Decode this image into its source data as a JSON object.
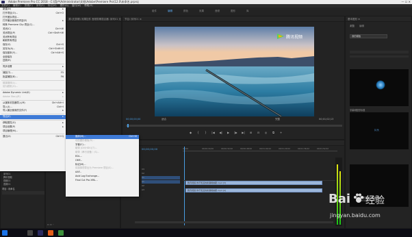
{
  "window": {
    "title": "Adobe Premiere Pro CC 2018 - C:\\用户\\Administrator\\文档\\Adobe\\Premiere Pro\\12.0\\未命名.prproj"
  },
  "menubar": [
    "文件(F)",
    "编辑(E)",
    "剪辑(C)",
    "序列(S)",
    "标记(M)",
    "图形(G)",
    "窗口(W)",
    "帮助(H)"
  ],
  "workspaces": {
    "items": [
      "组件",
      "编辑",
      "颜色",
      "效果",
      "音频",
      "图形",
      "库"
    ],
    "active": "编辑"
  },
  "file_menu": {
    "groups": [
      [
        {
          "label": "新建(N)",
          "shortcut": "▸"
        },
        {
          "label": "打开项目(O)...",
          "shortcut": "Ctrl+O"
        },
        {
          "label": "打开团队项目...",
          "shortcut": ""
        },
        {
          "label": "打开最近使用的内容(E)",
          "shortcut": "▸"
        },
        {
          "label": "转换 Premiere Clip 项目(C)...",
          "shortcut": ""
        },
        {
          "label": "关闭(C)",
          "shortcut": "Ctrl+W"
        },
        {
          "label": "关闭项目(P)",
          "shortcut": "Ctrl+Shift+W"
        },
        {
          "label": "关闭所有项目",
          "shortcut": ""
        },
        {
          "label": "刷新所有项目",
          "shortcut": ""
        },
        {
          "label": "保存(S)",
          "shortcut": "Ctrl+S"
        },
        {
          "label": "另存为(A)...",
          "shortcut": "Ctrl+Shift+S"
        },
        {
          "label": "保存副本(Y)...",
          "shortcut": "Ctrl+Alt+S"
        },
        {
          "label": "全部保存",
          "shortcut": ""
        },
        {
          "label": "还原(R)",
          "shortcut": ""
        }
      ],
      [
        {
          "label": "同步设置",
          "shortcut": "▸"
        }
      ],
      [
        {
          "label": "捕捉(T)...",
          "shortcut": "F5"
        },
        {
          "label": "批量捕捉(B)...",
          "shortcut": "F6"
        }
      ],
      [
        {
          "label": "链接媒体(L)...",
          "shortcut": "",
          "disabled": true
        },
        {
          "label": "设为脱机(O)...",
          "shortcut": "",
          "disabled": true
        }
      ],
      [
        {
          "label": "Adobe Dynamic Link(K)",
          "shortcut": "▸"
        },
        {
          "label": "Adobe Story(R)",
          "shortcut": "▸",
          "disabled": true
        }
      ],
      [
        {
          "label": "从媒体浏览器导入(M)",
          "shortcut": "Ctrl+Alt+I"
        },
        {
          "label": "导入(I)...",
          "shortcut": "Ctrl+I"
        },
        {
          "label": "导入最近使用的文件(F)",
          "shortcut": "▸"
        }
      ],
      [
        {
          "label": "导出(E)",
          "shortcut": "▸",
          "highlight": true
        }
      ],
      [
        {
          "label": "获取属性(G)",
          "shortcut": "▸"
        },
        {
          "label": "项目设置(P)",
          "shortcut": "▸"
        },
        {
          "label": "项目管理(M)...",
          "shortcut": ""
        }
      ],
      [
        {
          "label": "退出(X)",
          "shortcut": "Ctrl+Q"
        }
      ]
    ]
  },
  "export_submenu": {
    "items": [
      {
        "label": "媒体(M)...",
        "shortcut": "Ctrl+M",
        "highlight": true
      },
      {
        "label": "动态图形模板(R)...",
        "shortcut": "",
        "disabled": true
      },
      {
        "label": "字幕(C)...",
        "shortcut": ""
      },
      {
        "label": "磁带 (DV/HDV)(T)...",
        "shortcut": "",
        "disabled": true
      },
      {
        "label": "磁带（串行设备）(S)...",
        "shortcut": "",
        "disabled": true
      },
      {
        "label": "EDL...",
        "shortcut": ""
      },
      {
        "label": "OMF...",
        "shortcut": ""
      },
      {
        "label": "标记(M)...",
        "shortcut": ""
      },
      {
        "label": "将选择项导出为 Premiere 项目(S)...",
        "shortcut": "",
        "disabled": true
      },
      {
        "label": "AAF...",
        "shortcut": ""
      },
      {
        "label": "Avid Log Exchange...",
        "shortcut": ""
      },
      {
        "label": "Final Cut Pro XML...",
        "shortcut": ""
      }
    ]
  },
  "source_panel": {
    "title": "源:(无剪辑)  效果控件  音频剪辑混合器: 序列01  元数据"
  },
  "program_monitor": {
    "title": "节目: 序列01 ≡",
    "timecode_left": "00;00;00;00",
    "fit": "适合",
    "quality": "完整",
    "timecode_right": "00;01;02;13",
    "watermark": "腾讯视频"
  },
  "right_panel": {
    "tabs": [
      "基本图形 ≡",
      "浏览",
      "编辑"
    ],
    "button": "我的模板",
    "section_label": "字幕和图形标题",
    "template_caption": "运动图形模板已将其移除",
    "template_caption2": "Essential Graphics"
  },
  "timeline": {
    "title": "序列01 ≡",
    "timecode": "00;00;00;00",
    "ruler": [
      "00;00",
      "00;00;16;00",
      "00;00;32;00",
      "00;00;48;00",
      "00;01;04;02",
      "00;01;20;02",
      "00;01;36;02",
      "00;01;52;02"
    ],
    "track_labels": [
      "V3",
      "V2",
      "V1",
      "A1",
      "A2",
      "A3"
    ],
    "clip_label": "腾讯视频-你不知道的新疆喀纳斯.mp4 [V]",
    "clip_label_audio": "腾讯视频-你不知道的新疆喀纳斯.mp4 [A]"
  },
  "project_panel": {
    "title": "项目: 未命名 ≡",
    "items": [
      "序列01",
      "腾讯视频",
      "视频01",
      "音频01"
    ],
    "info": "项目: 未命名"
  },
  "watermark": {
    "brand": "Bai",
    "brand2": "经验",
    "url": "jingyan.baidu.com"
  },
  "colors": {
    "accent": "#3e7ad6",
    "ws_active": "#5ba3e6",
    "clip": "#9cb6da"
  }
}
